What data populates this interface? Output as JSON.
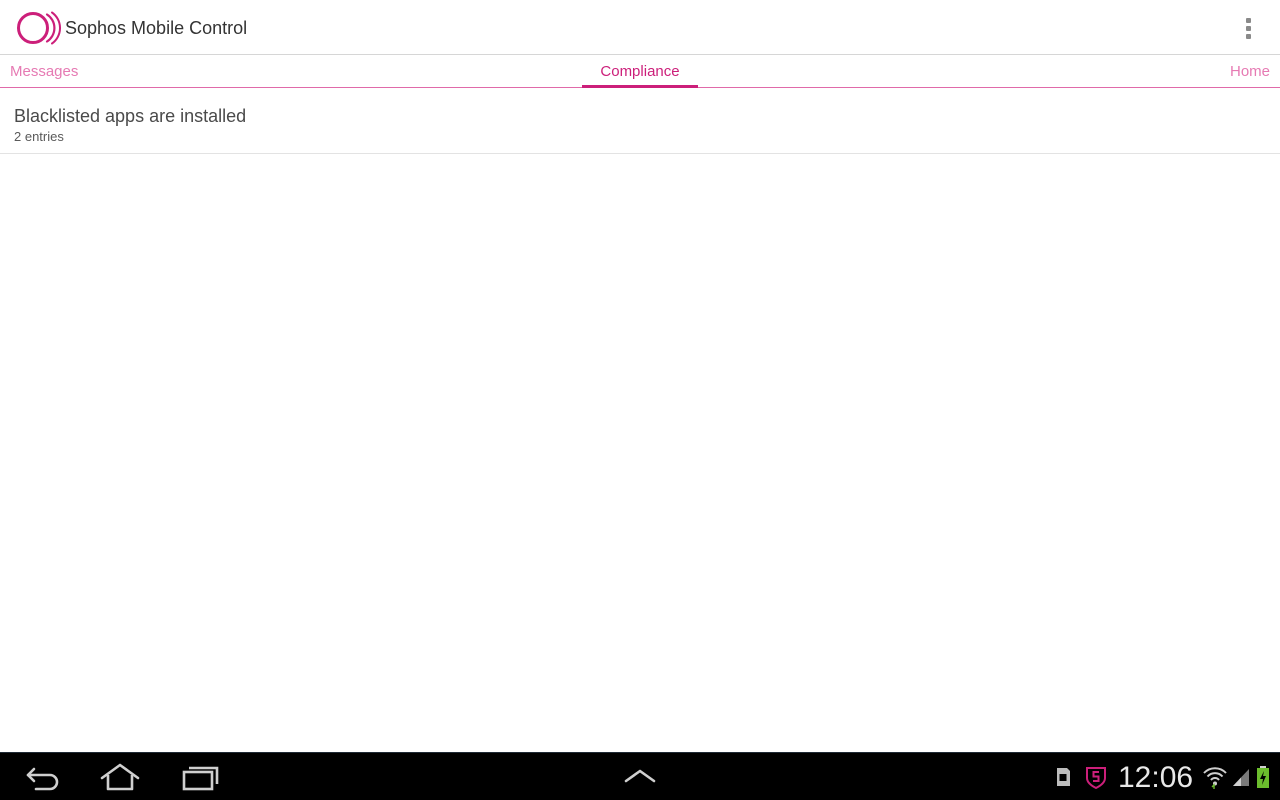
{
  "app": {
    "title": "Sophos Mobile Control",
    "brand_color": "#cc1f7a",
    "logo_icon": "sophos-logo-icon",
    "overflow_icon": "overflow-menu-icon"
  },
  "tabs": [
    {
      "label": "Messages",
      "selected": false
    },
    {
      "label": "Compliance",
      "selected": true
    },
    {
      "label": "Home",
      "selected": false
    }
  ],
  "list": {
    "items": [
      {
        "title": "Blacklisted apps are installed",
        "subtitle": "2 entries"
      }
    ]
  },
  "system_bar": {
    "clock": "12:06",
    "nav_icons": [
      "back-icon",
      "home-icon",
      "recent-apps-icon",
      "chevron-up-icon"
    ],
    "status_icons": [
      "sd-card-icon",
      "sophos-shield-icon",
      "wifi-icon",
      "signal-icon",
      "battery-charging-icon"
    ]
  }
}
